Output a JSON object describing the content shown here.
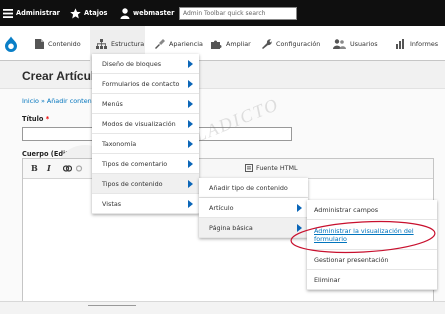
{
  "toolbar": {
    "admin_label": "Administrar",
    "shortcuts_label": "Atajos",
    "user_label": "webmaster",
    "search_placeholder": "Admin Toolbar quick search"
  },
  "tray": {
    "items": [
      {
        "label": "Contenido",
        "icon": "document-icon"
      },
      {
        "label": "Estructura",
        "icon": "structure-icon"
      },
      {
        "label": "Apariencia",
        "icon": "brush-icon"
      },
      {
        "label": "Ampliar",
        "icon": "puzzle-icon"
      },
      {
        "label": "Configuración",
        "icon": "wrench-icon"
      },
      {
        "label": "Usuarios",
        "icon": "people-icon"
      },
      {
        "label": "Informes",
        "icon": "bar-chart-icon"
      }
    ]
  },
  "page": {
    "title": "Crear Artícul",
    "breadcrumb": "Inicio » Añadir conten",
    "title_label": "Título",
    "title_required": "*",
    "body_label": "Cuerpo (Editar resun",
    "source_label": "Fuente HTML",
    "editor_buttons": [
      "B",
      "I"
    ]
  },
  "menu_structure": {
    "items": [
      "Diseño de bloques",
      "Formularios de contacto",
      "Menús",
      "Modos de visualización",
      "Taxonomía",
      "Tipos de comentario",
      "Tipos de contenido",
      "Vistas"
    ]
  },
  "menu_content_types": {
    "items": [
      "Añadir tipo de contenido"
    ]
  },
  "menu_types": {
    "items": [
      "Artículo",
      "Página básica"
    ]
  },
  "menu_article": {
    "items": [
      "Administrar campos",
      "Administrar la visualización del formulario",
      "Gestionar presentación",
      "Eliminar"
    ]
  },
  "watermark": "IRPALADICTO",
  "colors": {
    "toolbar_bg": "#0f0f0f",
    "link": "#0074bd",
    "arrow": "#0b66b8",
    "annotation": "#c8102e"
  }
}
